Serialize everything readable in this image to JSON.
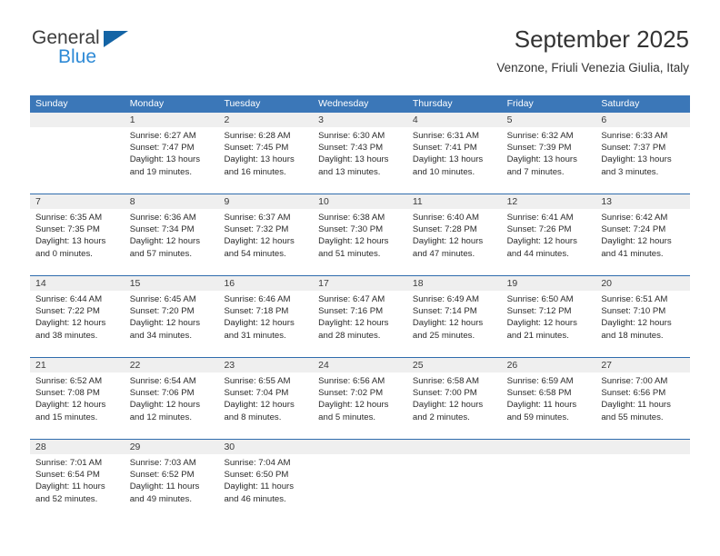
{
  "brand": {
    "name_part1": "General",
    "name_part2": "Blue",
    "triangle_icon": "triangle-icon",
    "color_dark": "#3c3c3c",
    "color_blue": "#2e8ad6",
    "color_triangle": "#1464a5"
  },
  "header": {
    "title": "September 2025",
    "subtitle": "Venzone, Friuli Venezia Giulia, Italy"
  },
  "colors": {
    "header_blue": "#3b77b8",
    "row_divider_blue": "#2f6cad",
    "date_band_gray": "#efefef",
    "text": "#2b2b2b"
  },
  "calendar": {
    "weekdays": [
      "Sunday",
      "Monday",
      "Tuesday",
      "Wednesday",
      "Thursday",
      "Friday",
      "Saturday"
    ],
    "weeks": [
      {
        "days": [
          {
            "num": "",
            "lines": []
          },
          {
            "num": "1",
            "lines": [
              "Sunrise: 6:27 AM",
              "Sunset: 7:47 PM",
              "Daylight: 13 hours",
              "and 19 minutes."
            ]
          },
          {
            "num": "2",
            "lines": [
              "Sunrise: 6:28 AM",
              "Sunset: 7:45 PM",
              "Daylight: 13 hours",
              "and 16 minutes."
            ]
          },
          {
            "num": "3",
            "lines": [
              "Sunrise: 6:30 AM",
              "Sunset: 7:43 PM",
              "Daylight: 13 hours",
              "and 13 minutes."
            ]
          },
          {
            "num": "4",
            "lines": [
              "Sunrise: 6:31 AM",
              "Sunset: 7:41 PM",
              "Daylight: 13 hours",
              "and 10 minutes."
            ]
          },
          {
            "num": "5",
            "lines": [
              "Sunrise: 6:32 AM",
              "Sunset: 7:39 PM",
              "Daylight: 13 hours",
              "and 7 minutes."
            ]
          },
          {
            "num": "6",
            "lines": [
              "Sunrise: 6:33 AM",
              "Sunset: 7:37 PM",
              "Daylight: 13 hours",
              "and 3 minutes."
            ]
          }
        ]
      },
      {
        "days": [
          {
            "num": "7",
            "lines": [
              "Sunrise: 6:35 AM",
              "Sunset: 7:35 PM",
              "Daylight: 13 hours",
              "and 0 minutes."
            ]
          },
          {
            "num": "8",
            "lines": [
              "Sunrise: 6:36 AM",
              "Sunset: 7:34 PM",
              "Daylight: 12 hours",
              "and 57 minutes."
            ]
          },
          {
            "num": "9",
            "lines": [
              "Sunrise: 6:37 AM",
              "Sunset: 7:32 PM",
              "Daylight: 12 hours",
              "and 54 minutes."
            ]
          },
          {
            "num": "10",
            "lines": [
              "Sunrise: 6:38 AM",
              "Sunset: 7:30 PM",
              "Daylight: 12 hours",
              "and 51 minutes."
            ]
          },
          {
            "num": "11",
            "lines": [
              "Sunrise: 6:40 AM",
              "Sunset: 7:28 PM",
              "Daylight: 12 hours",
              "and 47 minutes."
            ]
          },
          {
            "num": "12",
            "lines": [
              "Sunrise: 6:41 AM",
              "Sunset: 7:26 PM",
              "Daylight: 12 hours",
              "and 44 minutes."
            ]
          },
          {
            "num": "13",
            "lines": [
              "Sunrise: 6:42 AM",
              "Sunset: 7:24 PM",
              "Daylight: 12 hours",
              "and 41 minutes."
            ]
          }
        ]
      },
      {
        "days": [
          {
            "num": "14",
            "lines": [
              "Sunrise: 6:44 AM",
              "Sunset: 7:22 PM",
              "Daylight: 12 hours",
              "and 38 minutes."
            ]
          },
          {
            "num": "15",
            "lines": [
              "Sunrise: 6:45 AM",
              "Sunset: 7:20 PM",
              "Daylight: 12 hours",
              "and 34 minutes."
            ]
          },
          {
            "num": "16",
            "lines": [
              "Sunrise: 6:46 AM",
              "Sunset: 7:18 PM",
              "Daylight: 12 hours",
              "and 31 minutes."
            ]
          },
          {
            "num": "17",
            "lines": [
              "Sunrise: 6:47 AM",
              "Sunset: 7:16 PM",
              "Daylight: 12 hours",
              "and 28 minutes."
            ]
          },
          {
            "num": "18",
            "lines": [
              "Sunrise: 6:49 AM",
              "Sunset: 7:14 PM",
              "Daylight: 12 hours",
              "and 25 minutes."
            ]
          },
          {
            "num": "19",
            "lines": [
              "Sunrise: 6:50 AM",
              "Sunset: 7:12 PM",
              "Daylight: 12 hours",
              "and 21 minutes."
            ]
          },
          {
            "num": "20",
            "lines": [
              "Sunrise: 6:51 AM",
              "Sunset: 7:10 PM",
              "Daylight: 12 hours",
              "and 18 minutes."
            ]
          }
        ]
      },
      {
        "days": [
          {
            "num": "21",
            "lines": [
              "Sunrise: 6:52 AM",
              "Sunset: 7:08 PM",
              "Daylight: 12 hours",
              "and 15 minutes."
            ]
          },
          {
            "num": "22",
            "lines": [
              "Sunrise: 6:54 AM",
              "Sunset: 7:06 PM",
              "Daylight: 12 hours",
              "and 12 minutes."
            ]
          },
          {
            "num": "23",
            "lines": [
              "Sunrise: 6:55 AM",
              "Sunset: 7:04 PM",
              "Daylight: 12 hours",
              "and 8 minutes."
            ]
          },
          {
            "num": "24",
            "lines": [
              "Sunrise: 6:56 AM",
              "Sunset: 7:02 PM",
              "Daylight: 12 hours",
              "and 5 minutes."
            ]
          },
          {
            "num": "25",
            "lines": [
              "Sunrise: 6:58 AM",
              "Sunset: 7:00 PM",
              "Daylight: 12 hours",
              "and 2 minutes."
            ]
          },
          {
            "num": "26",
            "lines": [
              "Sunrise: 6:59 AM",
              "Sunset: 6:58 PM",
              "Daylight: 11 hours",
              "and 59 minutes."
            ]
          },
          {
            "num": "27",
            "lines": [
              "Sunrise: 7:00 AM",
              "Sunset: 6:56 PM",
              "Daylight: 11 hours",
              "and 55 minutes."
            ]
          }
        ]
      },
      {
        "days": [
          {
            "num": "28",
            "lines": [
              "Sunrise: 7:01 AM",
              "Sunset: 6:54 PM",
              "Daylight: 11 hours",
              "and 52 minutes."
            ]
          },
          {
            "num": "29",
            "lines": [
              "Sunrise: 7:03 AM",
              "Sunset: 6:52 PM",
              "Daylight: 11 hours",
              "and 49 minutes."
            ]
          },
          {
            "num": "30",
            "lines": [
              "Sunrise: 7:04 AM",
              "Sunset: 6:50 PM",
              "Daylight: 11 hours",
              "and 46 minutes."
            ]
          },
          {
            "num": "",
            "lines": []
          },
          {
            "num": "",
            "lines": []
          },
          {
            "num": "",
            "lines": []
          },
          {
            "num": "",
            "lines": []
          }
        ]
      }
    ]
  }
}
